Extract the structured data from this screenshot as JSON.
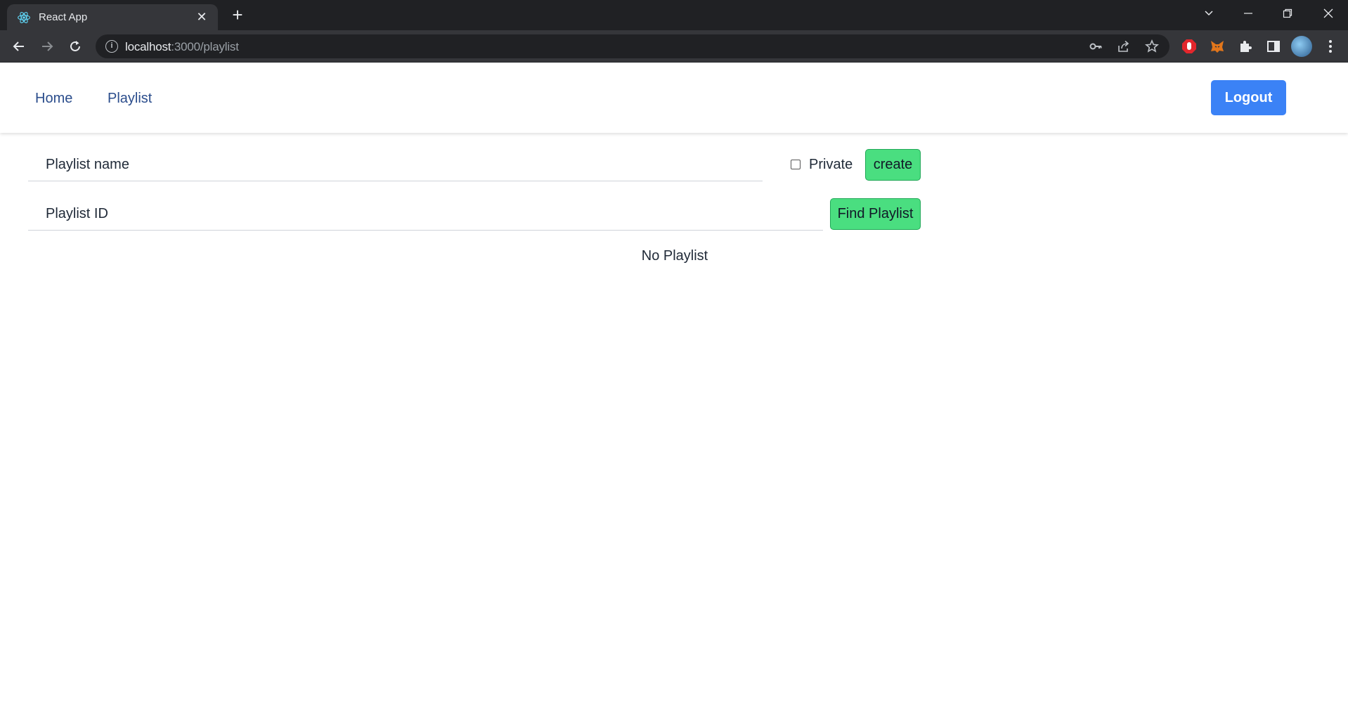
{
  "browser": {
    "tab_title": "React App",
    "url_host": "localhost",
    "url_path": ":3000/playlist",
    "new_tab_symbol": "+",
    "close_tab_symbol": "✕",
    "icons": [
      "react-icon",
      "back-icon",
      "forward-icon",
      "reload-icon",
      "info-icon",
      "key-icon",
      "share-icon",
      "star-icon",
      "adblock-icon",
      "metamask-icon",
      "extensions-icon",
      "sidepanel-icon",
      "profile-icon",
      "menu-icon",
      "tab-search-icon",
      "minimize-icon",
      "restore-icon",
      "close-window-icon"
    ]
  },
  "nav": {
    "home": "Home",
    "playlist": "Playlist",
    "logout": "Logout"
  },
  "create_form": {
    "name_placeholder": "Playlist name",
    "private_label": "Private",
    "private_checked": false,
    "create_label": "create"
  },
  "find_form": {
    "id_placeholder": "Playlist ID",
    "find_label": "Find Playlist"
  },
  "empty_text": "No Playlist",
  "colors": {
    "logout_bg": "#3b82f6",
    "action_button_bg": "#4ade80",
    "nav_link": "#2b4d8c"
  }
}
